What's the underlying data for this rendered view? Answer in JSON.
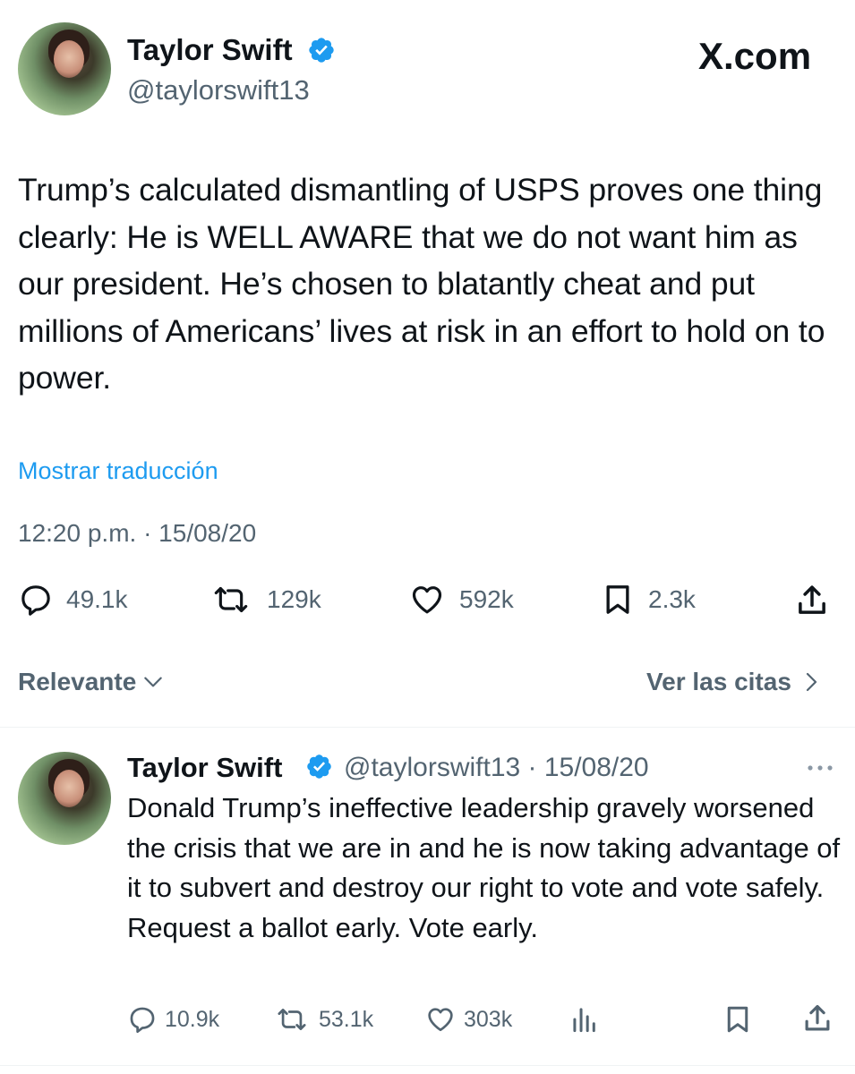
{
  "header": {
    "display_name": "Taylor Swift",
    "handle": "@taylorswift13",
    "watermark": "X.com",
    "verified_color": "#1d9bf0"
  },
  "tweet": {
    "text": "Trump’s calculated dismantling of USPS proves one thing clearly: He is WELL AWARE that we do not want him as our president. He’s chosen to blatantly cheat and put millions of Americans’ lives at risk in an effort to hold on to power.",
    "translate_label": "Mostrar traducción",
    "timestamp": "12:20 p.m. · 15/08/20",
    "actions": {
      "replies": "49.1k",
      "reposts": "129k",
      "likes": "592k",
      "bookmarks": "2.3k"
    },
    "accent_color": "#1d9bf0"
  },
  "replies_bar": {
    "sort_label": "Relevante",
    "quotes_label": "Ver las citas"
  },
  "reply": {
    "display_name": "Taylor Swift",
    "handle_date": "@taylorswift13 · 15/08/20",
    "text": "Donald Trump’s ineffective leadership gravely worsened the crisis that we are in and he is now taking advantage of it to subvert and destroy our right to vote and vote safely. Request a ballot early. Vote early.",
    "actions": {
      "replies": "10.9k",
      "reposts": "53.1k",
      "likes": "303k"
    }
  }
}
